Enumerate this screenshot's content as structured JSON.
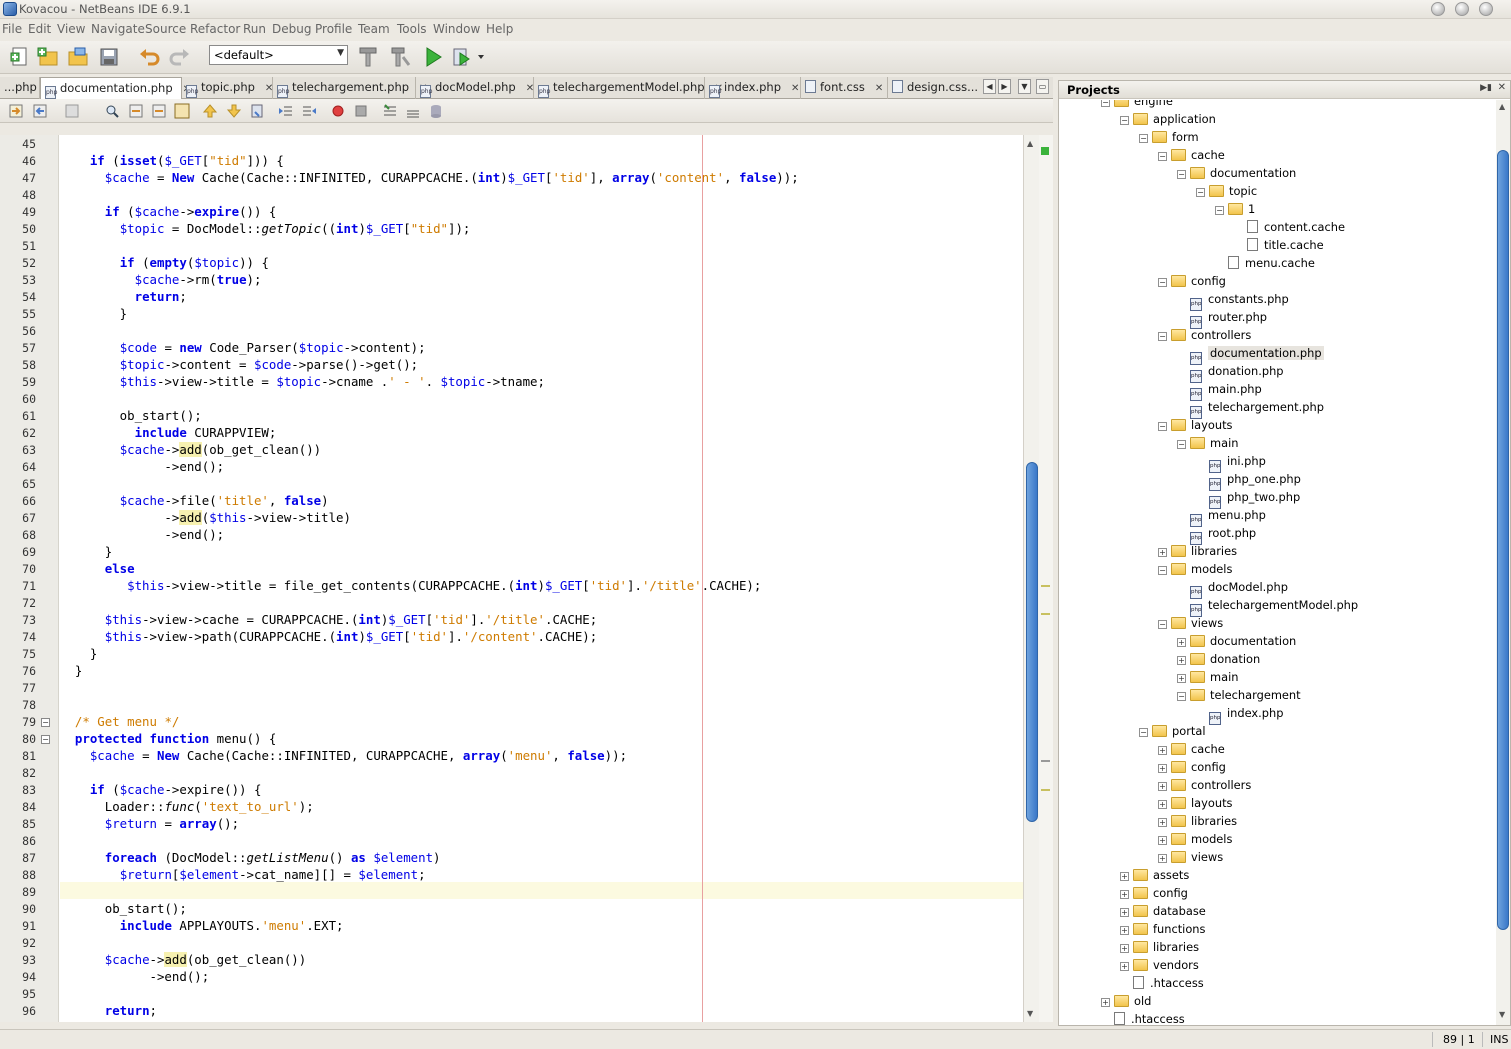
{
  "window": {
    "title": "Kovacou - NetBeans IDE 6.9.1"
  },
  "menu": [
    "File",
    "Edit",
    "View",
    "Navigate",
    "Source",
    "Refactor",
    "Run",
    "Debug",
    "Profile",
    "Team",
    "Tools",
    "Window",
    "Help"
  ],
  "toolbar": {
    "config": "<default>"
  },
  "tabs": [
    "...php",
    "documentation.php",
    "topic.php",
    "telechargement.php",
    "docModel.php",
    "telechargementModel.php",
    "index.php",
    "font.css",
    "design.css..."
  ],
  "editor": {
    "lines": [
      {
        "n": "45",
        "t": ""
      },
      {
        "n": "46",
        "t": "    <k>if</k> (<k>isset</k>(<v>$_GET</v>[<s>\"tid\"</s>])) {"
      },
      {
        "n": "47",
        "t": "      <v>$cache</v> = <k>New</k> Cache(Cache::INFINITED, CURAPPCACHE.(<k>int</k>)<v>$_GET</v>[<s>'tid'</s>], <k>array</k>(<s>'content'</s>, <k>false</k>));"
      },
      {
        "n": "48",
        "t": ""
      },
      {
        "n": "49",
        "t": "      <k>if</k> (<v>$cache</v>-><k>expire</k>()) {"
      },
      {
        "n": "50",
        "t": "        <v>$topic</v> = DocModel::<i>getTopic</i>((<k>int</k>)<v>$_GET</v>[<s>\"tid\"</s>]);"
      },
      {
        "n": "51",
        "t": ""
      },
      {
        "n": "52",
        "t": "        <k>if</k> (<k>empty</k>(<v>$topic</v>)) {"
      },
      {
        "n": "53",
        "t": "          <v>$cache</v>->rm(<k>true</k>);"
      },
      {
        "n": "54",
        "t": "          <k>return</k>;"
      },
      {
        "n": "55",
        "t": "        }"
      },
      {
        "n": "56",
        "t": ""
      },
      {
        "n": "57",
        "t": "        <v>$code</v> = <k>new</k> Code_Parser(<v>$topic</v>->content);"
      },
      {
        "n": "58",
        "t": "        <v>$topic</v>->content = <v>$code</v>->parse()->get();"
      },
      {
        "n": "59",
        "t": "        <v>$this</v>->view->title = <v>$topic</v>->cname .<s>' - '</s>. <v>$topic</v>->tname;"
      },
      {
        "n": "60",
        "t": ""
      },
      {
        "n": "61",
        "t": "        ob_start();"
      },
      {
        "n": "62",
        "t": "          <k>include</k> CURAPPVIEW;"
      },
      {
        "n": "63",
        "t": "        <v>$cache</v>-><m>add</m>(ob_get_clean())"
      },
      {
        "n": "64",
        "t": "              ->end();"
      },
      {
        "n": "65",
        "t": ""
      },
      {
        "n": "66",
        "t": "        <v>$cache</v>->file(<s>'title'</s>, <k>false</k>)"
      },
      {
        "n": "67",
        "t": "              -><m>add</m>(<v>$this</v>->view->title)"
      },
      {
        "n": "68",
        "t": "              ->end();"
      },
      {
        "n": "69",
        "t": "      }"
      },
      {
        "n": "70",
        "t": "      <k>else</k>"
      },
      {
        "n": "71",
        "t": "         <v>$this</v>->view->title = file_get_contents(CURAPPCACHE.(<k>int</k>)<v>$_GET</v>[<s>'tid'</s>].<s>'/title'</s>.CACHE);"
      },
      {
        "n": "72",
        "t": ""
      },
      {
        "n": "73",
        "t": "      <v>$this</v>->view->cache = CURAPPCACHE.(<k>int</k>)<v>$_GET</v>[<s>'tid'</s>].<s>'/title'</s>.CACHE;"
      },
      {
        "n": "74",
        "t": "      <v>$this</v>->view->path(CURAPPCACHE.(<k>int</k>)<v>$_GET</v>[<s>'tid'</s>].<s>'/content'</s>.CACHE);"
      },
      {
        "n": "75",
        "t": "    }"
      },
      {
        "n": "76",
        "t": "  }"
      },
      {
        "n": "77",
        "t": ""
      },
      {
        "n": "78",
        "t": ""
      },
      {
        "n": "79",
        "t": "  <s>/* Get menu */</s>"
      },
      {
        "n": "80",
        "t": "  <k>protected function</k> menu() {"
      },
      {
        "n": "81",
        "t": "    <v>$cache</v> = <k>New</k> Cache(Cache::INFINITED, CURAPPCACHE, <k>array</k>(<s>'menu'</s>, <k>false</k>));"
      },
      {
        "n": "82",
        "t": ""
      },
      {
        "n": "83",
        "t": "    <k>if</k> (<v>$cache</v>->expire()) {"
      },
      {
        "n": "84",
        "t": "      Loader::<i>func</i>(<s>'text_to_url'</s>);"
      },
      {
        "n": "85",
        "t": "      <v>$return</v> = <k>array</k>();"
      },
      {
        "n": "86",
        "t": ""
      },
      {
        "n": "87",
        "t": "      <k>foreach</k> (DocModel::<i>getListMenu</i>() <k>as</k> <v>$element</v>)"
      },
      {
        "n": "88",
        "t": "        <v>$return</v>[<v>$element</v>->cat_name][] = <v>$element</v>;"
      },
      {
        "n": "89",
        "t": ""
      },
      {
        "n": "90",
        "t": "      ob_start();"
      },
      {
        "n": "91",
        "t": "        <k>include</k> APPLAYOUTS.<s>'menu'</s>.EXT;"
      },
      {
        "n": "92",
        "t": ""
      },
      {
        "n": "93",
        "t": "      <v>$cache</v>-><m>add</m>(ob_get_clean())"
      },
      {
        "n": "94",
        "t": "            ->end();"
      },
      {
        "n": "95",
        "t": ""
      },
      {
        "n": "96",
        "t": "      <k>return</k>;"
      }
    ]
  },
  "projects": {
    "header": "Projects",
    "tree": [
      {
        "d": 1,
        "t": "engine",
        "k": "folder",
        "e": "-"
      },
      {
        "d": 2,
        "t": "application",
        "k": "folder",
        "e": "-"
      },
      {
        "d": 3,
        "t": "form",
        "k": "folder",
        "e": "-"
      },
      {
        "d": 4,
        "t": "cache",
        "k": "folder",
        "e": "-"
      },
      {
        "d": 5,
        "t": "documentation",
        "k": "folder",
        "e": "-"
      },
      {
        "d": 6,
        "t": "topic",
        "k": "folder",
        "e": "-"
      },
      {
        "d": 7,
        "t": "1",
        "k": "folder",
        "e": "-"
      },
      {
        "d": 8,
        "t": "content.cache",
        "k": "file"
      },
      {
        "d": 8,
        "t": "title.cache",
        "k": "file"
      },
      {
        "d": 7,
        "t": "menu.cache",
        "k": "file"
      },
      {
        "d": 4,
        "t": "config",
        "k": "folder",
        "e": "-"
      },
      {
        "d": 5,
        "t": "constants.php",
        "k": "php"
      },
      {
        "d": 5,
        "t": "router.php",
        "k": "php"
      },
      {
        "d": 4,
        "t": "controllers",
        "k": "folder",
        "e": "-"
      },
      {
        "d": 5,
        "t": "documentation.php",
        "k": "php",
        "sel": true
      },
      {
        "d": 5,
        "t": "donation.php",
        "k": "php"
      },
      {
        "d": 5,
        "t": "main.php",
        "k": "php"
      },
      {
        "d": 5,
        "t": "telechargement.php",
        "k": "php"
      },
      {
        "d": 4,
        "t": "layouts",
        "k": "folder",
        "e": "-"
      },
      {
        "d": 5,
        "t": "main",
        "k": "folder",
        "e": "-"
      },
      {
        "d": 6,
        "t": "ini.php",
        "k": "php"
      },
      {
        "d": 6,
        "t": "php_one.php",
        "k": "php"
      },
      {
        "d": 6,
        "t": "php_two.php",
        "k": "php"
      },
      {
        "d": 5,
        "t": "menu.php",
        "k": "php"
      },
      {
        "d": 5,
        "t": "root.php",
        "k": "php"
      },
      {
        "d": 4,
        "t": "libraries",
        "k": "folder",
        "e": "+"
      },
      {
        "d": 4,
        "t": "models",
        "k": "folder",
        "e": "-"
      },
      {
        "d": 5,
        "t": "docModel.php",
        "k": "php"
      },
      {
        "d": 5,
        "t": "telechargementModel.php",
        "k": "php"
      },
      {
        "d": 4,
        "t": "views",
        "k": "folder",
        "e": "-"
      },
      {
        "d": 5,
        "t": "documentation",
        "k": "folder",
        "e": "+"
      },
      {
        "d": 5,
        "t": "donation",
        "k": "folder",
        "e": "+"
      },
      {
        "d": 5,
        "t": "main",
        "k": "folder",
        "e": "+"
      },
      {
        "d": 5,
        "t": "telechargement",
        "k": "folder",
        "e": "-"
      },
      {
        "d": 6,
        "t": "index.php",
        "k": "php"
      },
      {
        "d": 3,
        "t": "portal",
        "k": "folder",
        "e": "-"
      },
      {
        "d": 4,
        "t": "cache",
        "k": "folder",
        "e": "+"
      },
      {
        "d": 4,
        "t": "config",
        "k": "folder",
        "e": "+"
      },
      {
        "d": 4,
        "t": "controllers",
        "k": "folder",
        "e": "+"
      },
      {
        "d": 4,
        "t": "layouts",
        "k": "folder",
        "e": "+"
      },
      {
        "d": 4,
        "t": "libraries",
        "k": "folder",
        "e": "+"
      },
      {
        "d": 4,
        "t": "models",
        "k": "folder",
        "e": "+"
      },
      {
        "d": 4,
        "t": "views",
        "k": "folder",
        "e": "+"
      },
      {
        "d": 2,
        "t": "assets",
        "k": "folder",
        "e": "+"
      },
      {
        "d": 2,
        "t": "config",
        "k": "folder",
        "e": "+"
      },
      {
        "d": 2,
        "t": "database",
        "k": "folder",
        "e": "+"
      },
      {
        "d": 2,
        "t": "functions",
        "k": "folder",
        "e": "+"
      },
      {
        "d": 2,
        "t": "libraries",
        "k": "folder",
        "e": "+"
      },
      {
        "d": 2,
        "t": "vendors",
        "k": "folder",
        "e": "+"
      },
      {
        "d": 2,
        "t": ".htaccess",
        "k": "file"
      },
      {
        "d": 1,
        "t": "old",
        "k": "folder",
        "e": "+"
      },
      {
        "d": 1,
        "t": ".htaccess",
        "k": "file"
      }
    ]
  },
  "status": {
    "position": "89 | 1",
    "mode": "INS"
  }
}
